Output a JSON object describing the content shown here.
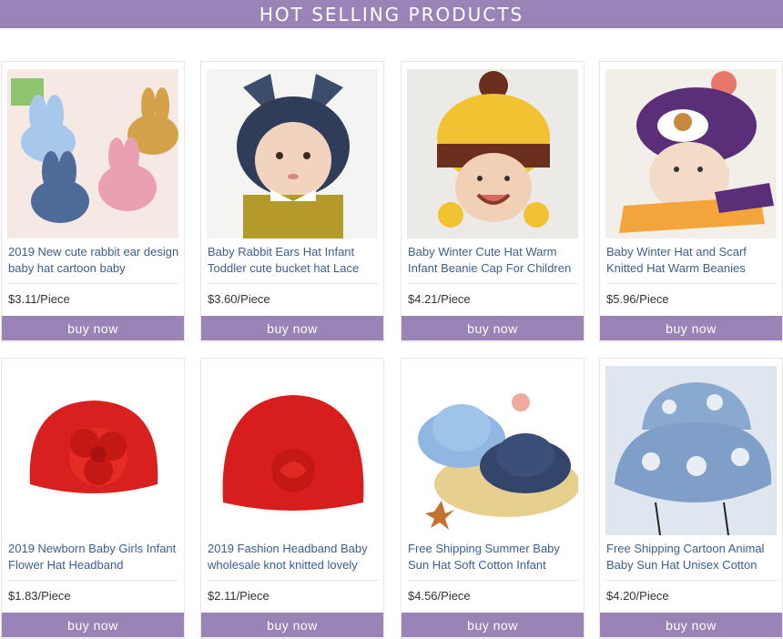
{
  "header": {
    "title": "HOT SELLING PRODUCTS"
  },
  "colors": {
    "accent": "#9a83b6",
    "title_text": "#3b5f8f",
    "price_text": "#333333"
  },
  "products": [
    {
      "title": "2019 New cute rabbit ear design baby hat cartoon baby",
      "price": "$3.11/Piece",
      "buy_label": "buy now",
      "image": "rabbit-ear-caps"
    },
    {
      "title": "Baby Rabbit Ears Hat Infant Toddler cute bucket hat Lace",
      "price": "$3.60/Piece",
      "buy_label": "buy now",
      "image": "baby-rabbit-ear-hat"
    },
    {
      "title": "Baby Winter Cute Hat Warm Infant Beanie Cap For Children",
      "price": "$4.21/Piece",
      "buy_label": "buy now",
      "image": "yellow-winter-beanie"
    },
    {
      "title": "Baby Winter Hat and Scarf Knitted Hat Warm Beanies",
      "price": "$5.96/Piece",
      "buy_label": "buy now",
      "image": "purple-knit-hat-scarf"
    },
    {
      "title": "2019 Newborn Baby Girls Infant Flower Hat Headband",
      "price": "$1.83/Piece",
      "buy_label": "buy now",
      "image": "red-flower-turban"
    },
    {
      "title": "2019 Fashion Headband Baby wholesale knot knitted lovely",
      "price": "$2.11/Piece",
      "buy_label": "buy now",
      "image": "red-knot-turban"
    },
    {
      "title": "Free Shipping Summer Baby Sun Hat Soft Cotton Infant",
      "price": "$4.56/Piece",
      "buy_label": "buy now",
      "image": "denim-bucket-hats"
    },
    {
      "title": "Free Shipping Cartoon Animal Baby Sun Hat Unisex Cotton",
      "price": "$4.20/Piece",
      "buy_label": "buy now",
      "image": "animal-print-bucket-hat"
    }
  ]
}
